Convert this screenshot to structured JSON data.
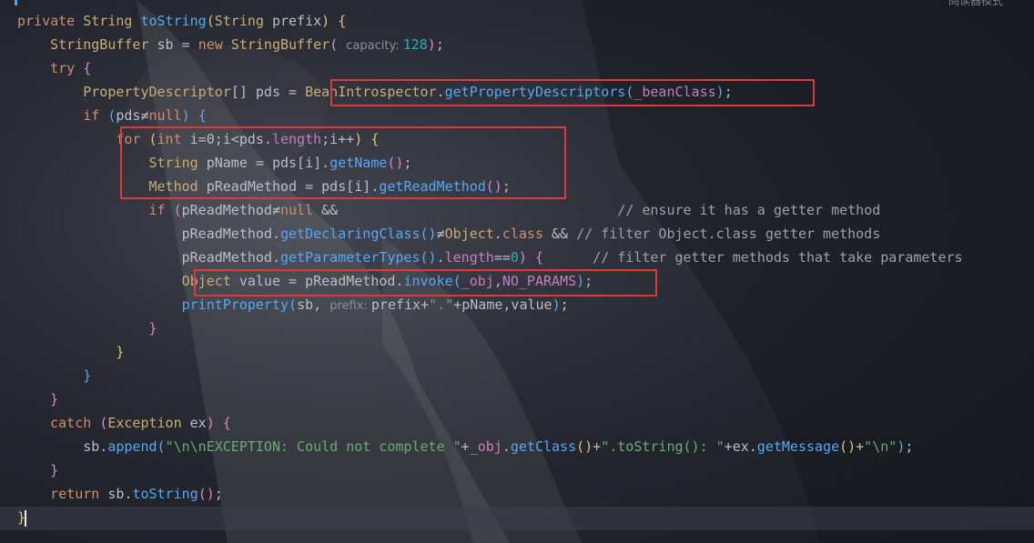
{
  "editor": {
    "reader_mode_label": "阅读器模式",
    "lines": [
      [
        [
          "kw",
          "private "
        ],
        [
          "ty",
          "String "
        ],
        [
          "fn",
          "toString"
        ],
        [
          "br1",
          "("
        ],
        [
          "ty",
          "String "
        ],
        [
          "pl",
          "prefix"
        ],
        [
          "br1",
          ")"
        ],
        [
          "pl",
          " "
        ],
        [
          "br1",
          "{"
        ]
      ],
      [
        [
          "pl",
          "    "
        ],
        [
          "ty",
          "StringBuffer "
        ],
        [
          "pl",
          "sb = "
        ],
        [
          "kw",
          "new "
        ],
        [
          "ty",
          "StringBuffer"
        ],
        [
          "br2",
          "("
        ],
        [
          "pl",
          " "
        ],
        [
          "hint",
          "capacity: "
        ],
        [
          "nu",
          "128"
        ],
        [
          "br2",
          ")"
        ],
        [
          "pl",
          ";"
        ]
      ],
      [
        [
          "pl",
          "    "
        ],
        [
          "kw",
          "try "
        ],
        [
          "br2",
          "{"
        ]
      ],
      [
        [
          "pl",
          "        "
        ],
        [
          "ty",
          "PropertyDescriptor"
        ],
        [
          "pl",
          "[] pds = "
        ],
        [
          "ty",
          "BeanIntrospector"
        ],
        [
          "pl",
          "."
        ],
        [
          "fn",
          "getPropertyDescriptors"
        ],
        [
          "br3",
          "("
        ],
        [
          "pf",
          "_beanClass"
        ],
        [
          "br3",
          ")"
        ],
        [
          "pl",
          ";"
        ]
      ],
      [
        [
          "pl",
          "        "
        ],
        [
          "kw",
          "if "
        ],
        [
          "br3",
          "("
        ],
        [
          "pl",
          "pds≠"
        ],
        [
          "kw",
          "null"
        ],
        [
          "br3",
          ")"
        ],
        [
          "pl",
          " "
        ],
        [
          "br3",
          "{"
        ]
      ],
      [
        [
          "pl",
          "            "
        ],
        [
          "kw",
          "for "
        ],
        [
          "br1",
          "("
        ],
        [
          "kw",
          "int "
        ],
        [
          "pl",
          "i=0;i<pds."
        ],
        [
          "pf",
          "length"
        ],
        [
          "pl",
          ";i++"
        ],
        [
          "br1",
          ")"
        ],
        [
          "pl",
          " "
        ],
        [
          "br1",
          "{"
        ]
      ],
      [
        [
          "pl",
          "                "
        ],
        [
          "ty",
          "String "
        ],
        [
          "pl",
          "pName = pds[i]."
        ],
        [
          "fn",
          "getName"
        ],
        [
          "br2",
          "()"
        ],
        [
          "pl",
          ";"
        ]
      ],
      [
        [
          "pl",
          "                "
        ],
        [
          "ty",
          "Method "
        ],
        [
          "pl",
          "pReadMethod = pds[i]."
        ],
        [
          "fn",
          "getReadMethod"
        ],
        [
          "br2",
          "()"
        ],
        [
          "pl",
          ";"
        ]
      ],
      [
        [
          "pl",
          "                "
        ],
        [
          "kw",
          "if "
        ],
        [
          "br2",
          "("
        ],
        [
          "pl",
          "pReadMethod≠"
        ],
        [
          "kw",
          "null "
        ],
        [
          "pl",
          "&&                                  "
        ],
        [
          "cm",
          "// ensure it has a getter method"
        ]
      ],
      [
        [
          "pl",
          "                    pReadMethod."
        ],
        [
          "fn",
          "getDeclaringClass"
        ],
        [
          "br3",
          "()"
        ],
        [
          "pl",
          "≠"
        ],
        [
          "ty",
          "Object"
        ],
        [
          "pl",
          "."
        ],
        [
          "kw",
          "class "
        ],
        [
          "pl",
          "&& "
        ],
        [
          "cm",
          "// filter Object.class getter methods"
        ]
      ],
      [
        [
          "pl",
          "                    pReadMethod."
        ],
        [
          "fn",
          "getParameterTypes"
        ],
        [
          "br3",
          "()"
        ],
        [
          "pl",
          "."
        ],
        [
          "pf",
          "length"
        ],
        [
          "pl",
          "=="
        ],
        [
          "nu",
          "0"
        ],
        [
          "br2",
          ")"
        ],
        [
          "pl",
          " "
        ],
        [
          "br2",
          "{"
        ],
        [
          "pl",
          "      "
        ],
        [
          "cm",
          "// filter getter methods that take parameters"
        ]
      ],
      [
        [
          "pl",
          "                    "
        ],
        [
          "ty",
          "Object "
        ],
        [
          "pl",
          "value = pReadMethod."
        ],
        [
          "fn",
          "invoke"
        ],
        [
          "br3",
          "("
        ],
        [
          "pf",
          "_obj"
        ],
        [
          "pl",
          ","
        ],
        [
          "pf",
          "NO_PARAMS"
        ],
        [
          "br3",
          ")"
        ],
        [
          "pl",
          ";"
        ]
      ],
      [
        [
          "pl",
          "                    "
        ],
        [
          "fn",
          "printProperty"
        ],
        [
          "br3",
          "("
        ],
        [
          "pl",
          "sb, "
        ],
        [
          "hint",
          "prefix: "
        ],
        [
          "pl",
          "prefix+"
        ],
        [
          "st",
          "\".\""
        ],
        [
          "pl",
          "+pName,value"
        ],
        [
          "br3",
          ")"
        ],
        [
          "pl",
          ";"
        ]
      ],
      [
        [
          "pl",
          "                "
        ],
        [
          "br2",
          "}"
        ]
      ],
      [
        [
          "pl",
          "            "
        ],
        [
          "br1",
          "}"
        ]
      ],
      [
        [
          "pl",
          "        "
        ],
        [
          "br3",
          "}"
        ]
      ],
      [
        [
          "pl",
          "    "
        ],
        [
          "br2",
          "}"
        ]
      ],
      [
        [
          "pl",
          "    "
        ],
        [
          "kw",
          "catch "
        ],
        [
          "br2",
          "("
        ],
        [
          "ty",
          "Exception "
        ],
        [
          "pl",
          "ex"
        ],
        [
          "br2",
          ")"
        ],
        [
          "pl",
          " "
        ],
        [
          "br2",
          "{"
        ]
      ],
      [
        [
          "pl",
          "        sb."
        ],
        [
          "fn",
          "append"
        ],
        [
          "br3",
          "("
        ],
        [
          "st",
          "\"\\n\\nEXCEPTION: Could not complete \""
        ],
        [
          "pl",
          "+"
        ],
        [
          "pf",
          "_obj"
        ],
        [
          "pl",
          "."
        ],
        [
          "fn",
          "getClass"
        ],
        [
          "br1",
          "()"
        ],
        [
          "pl",
          "+"
        ],
        [
          "st",
          "\".toString(): \""
        ],
        [
          "pl",
          "+ex."
        ],
        [
          "fn",
          "getMessage"
        ],
        [
          "br1",
          "()"
        ],
        [
          "pl",
          "+"
        ],
        [
          "st",
          "\"\\n\""
        ],
        [
          "br3",
          ")"
        ],
        [
          "pl",
          ";"
        ]
      ],
      [
        [
          "pl",
          "    "
        ],
        [
          "br2",
          "}"
        ]
      ],
      [
        [
          "pl",
          "    "
        ],
        [
          "kw",
          "return "
        ],
        [
          "pl",
          "sb."
        ],
        [
          "fn",
          "toString"
        ],
        [
          "br2",
          "()"
        ],
        [
          "pl",
          ";"
        ]
      ],
      [
        [
          "br1",
          "}"
        ]
      ]
    ]
  },
  "colors": {
    "keyword": "#cf8e6d",
    "type": "#c8ae74",
    "method": "#56a8f5",
    "field": "#c77dbb",
    "string": "#6aab73",
    "number": "#2aacb8",
    "comment": "#9da0a8",
    "highlight_box": "#e0393b"
  }
}
